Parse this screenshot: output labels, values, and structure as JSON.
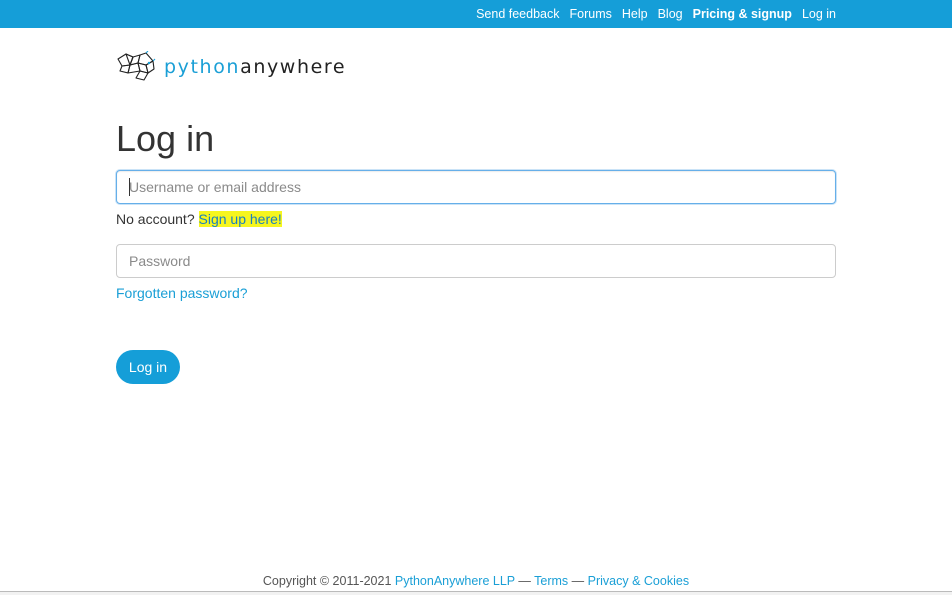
{
  "topnav": {
    "send_feedback": "Send feedback",
    "forums": "Forums",
    "help": "Help",
    "blog": "Blog",
    "pricing": "Pricing & signup",
    "login": "Log in"
  },
  "logo": {
    "part1": "python",
    "part2": "anywhere",
    "icon": "python-snake-logo-icon"
  },
  "page_title": "Log in",
  "username": {
    "placeholder": "Username or email address",
    "value": ""
  },
  "signup": {
    "prompt": "No account?",
    "link": "Sign up here!"
  },
  "password": {
    "placeholder": "Password",
    "value": ""
  },
  "forgot_link": "Forgotten password?",
  "login_button": "Log in",
  "footer": {
    "copyright": "Copyright © 2011-2021",
    "company": "PythonAnywhere LLP",
    "sep1": "—",
    "terms": "Terms",
    "sep2": "—",
    "privacy": "Privacy & Cookies"
  },
  "colors": {
    "accent": "#159ed8",
    "link": "#1a9fd6",
    "highlight": "#f6f61e"
  }
}
